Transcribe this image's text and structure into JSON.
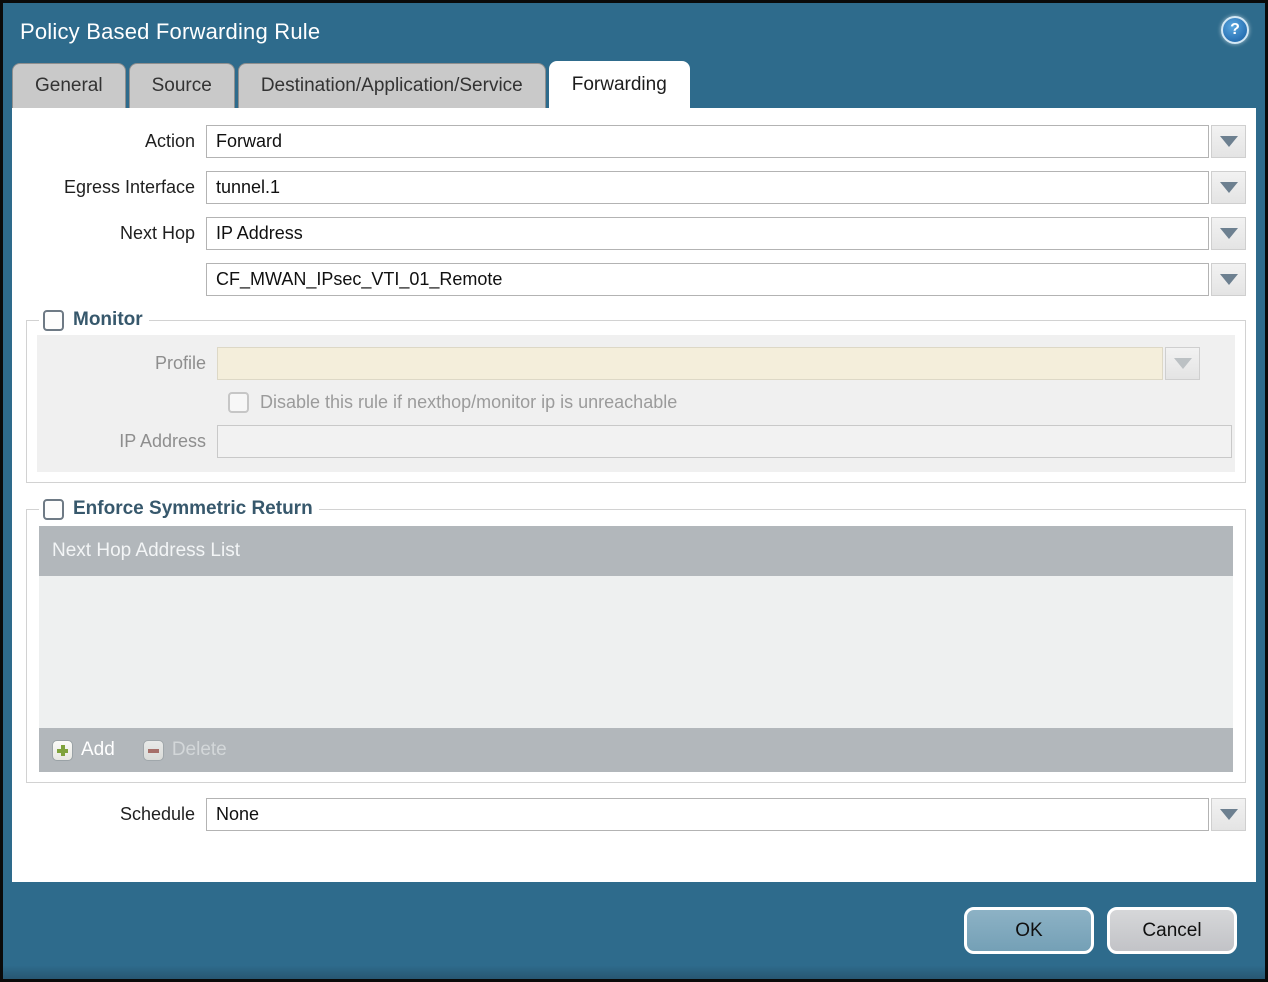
{
  "window": {
    "title": "Policy Based Forwarding Rule"
  },
  "tabs": [
    {
      "label": "General"
    },
    {
      "label": "Source"
    },
    {
      "label": "Destination/Application/Service"
    },
    {
      "label": "Forwarding"
    }
  ],
  "active_tab": "Forwarding",
  "form": {
    "action": {
      "label": "Action",
      "value": "Forward"
    },
    "egress_interface": {
      "label": "Egress Interface",
      "value": "tunnel.1"
    },
    "next_hop": {
      "label": "Next Hop",
      "value": "IP Address"
    },
    "next_hop_address": {
      "value": "CF_MWAN_IPsec_VTI_01_Remote"
    },
    "schedule": {
      "label": "Schedule",
      "value": "None"
    }
  },
  "monitor": {
    "title": "Monitor",
    "checked": false,
    "profile": {
      "label": "Profile",
      "value": ""
    },
    "disable_rule_label": "Disable this rule if nexthop/monitor ip is unreachable",
    "disable_rule_checked": false,
    "ip_address": {
      "label": "IP Address",
      "value": ""
    }
  },
  "symmetric_return": {
    "title": "Enforce Symmetric Return",
    "checked": false,
    "table_header": "Next Hop Address List",
    "rows": [],
    "add_label": "Add",
    "delete_label": "Delete",
    "delete_enabled": false
  },
  "footer": {
    "ok_label": "OK",
    "cancel_label": "Cancel"
  },
  "icons": {
    "help": "?",
    "dropdown": "chevron-down",
    "add": "plus",
    "delete": "minus"
  },
  "colors": {
    "frame_teal": "#2e6b8c",
    "active_tab_bg": "#ffffff",
    "inactive_tab_bg": "#c9c9c9",
    "section_title": "#37586c",
    "disabled_field_cream": "#f4eedb",
    "panel_gray": "#f0f0f0",
    "table_header_gray": "#b2b7bb",
    "table_body_gray": "#eef0f0",
    "add_icon_green": "#7fa33c",
    "delete_icon_red": "#a2574e",
    "ok_button_blue": "#7fa9bd",
    "cancel_button_gray": "#c9cbce",
    "help_icon_blue": "#2a72b4"
  }
}
